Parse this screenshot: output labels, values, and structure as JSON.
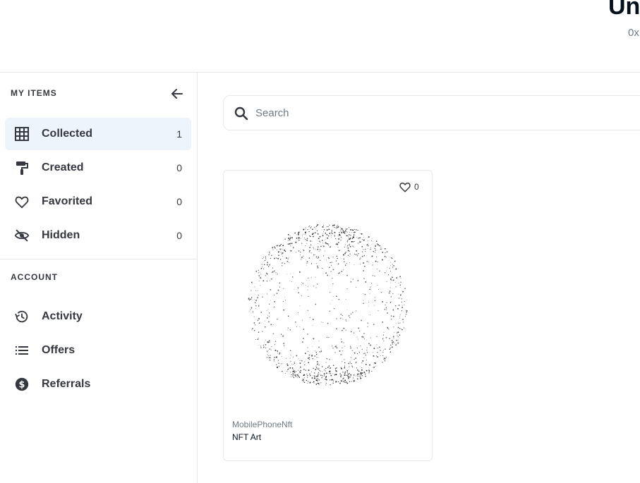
{
  "profile": {
    "name": "Un",
    "address": "0x"
  },
  "sidebar": {
    "my_items_heading": "MY ITEMS",
    "items": [
      {
        "label": "Collected",
        "count": "1",
        "icon": "grid-icon",
        "active": true
      },
      {
        "label": "Created",
        "count": "0",
        "icon": "paint-roller-icon",
        "active": false
      },
      {
        "label": "Favorited",
        "count": "0",
        "icon": "heart-icon",
        "active": false
      },
      {
        "label": "Hidden",
        "count": "0",
        "icon": "eye-off-icon",
        "active": false
      }
    ],
    "account_heading": "ACCOUNT",
    "account_items": [
      {
        "label": "Activity",
        "icon": "history-icon"
      },
      {
        "label": "Offers",
        "icon": "list-icon"
      },
      {
        "label": "Referrals",
        "icon": "dollar-circle-icon"
      }
    ]
  },
  "search": {
    "placeholder": "Search"
  },
  "cards": [
    {
      "collection": "MobilePhoneNft",
      "name": "NFT Art",
      "favorites": "0"
    }
  ],
  "colors": {
    "accent_bg": "#eef4fb",
    "text": "#353840",
    "muted": "#707a83",
    "border": "#e5e8eb"
  }
}
